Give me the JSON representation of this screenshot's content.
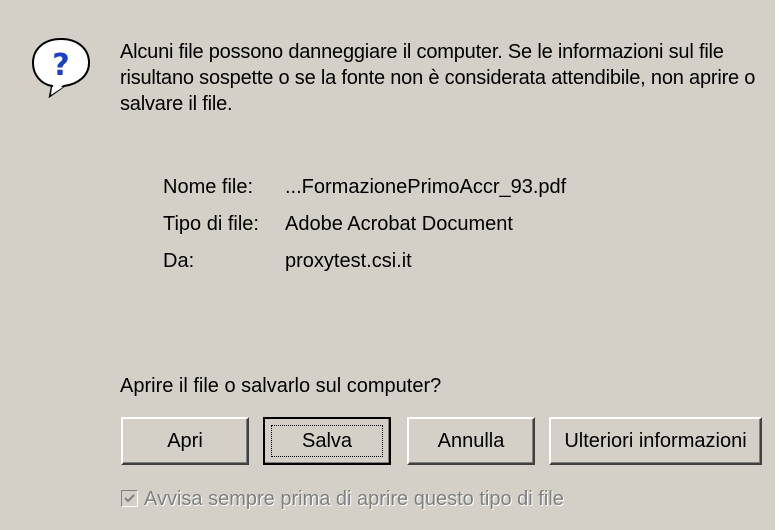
{
  "dialog": {
    "icon": "question-icon",
    "warning_text": "Alcuni file possono danneggiare il computer. Se le informazioni sul file risultano sospette o se la fonte non è considerata attendibile, non aprire o salvare il file.",
    "file_info": [
      {
        "label": "Nome file:",
        "value": "...FormazionePrimoAccr_93.pdf"
      },
      {
        "label": "Tipo di file:",
        "value": "Adobe Acrobat Document"
      },
      {
        "label": "Da:",
        "value": "proxytest.csi.it"
      }
    ],
    "question": "Aprire il file o salvarlo sul computer?",
    "buttons": {
      "open": "Apri",
      "save": "Salva",
      "cancel": "Annulla",
      "more_info": "Ulteriori informazioni"
    },
    "checkbox": {
      "label": "Avvisa sempre prima di aprire questo tipo di file",
      "checked": true,
      "enabled": false
    }
  },
  "colors": {
    "dialog_bg": "#d4d0c8",
    "icon_blue": "#1a3fc8",
    "disabled_text": "#808080"
  }
}
